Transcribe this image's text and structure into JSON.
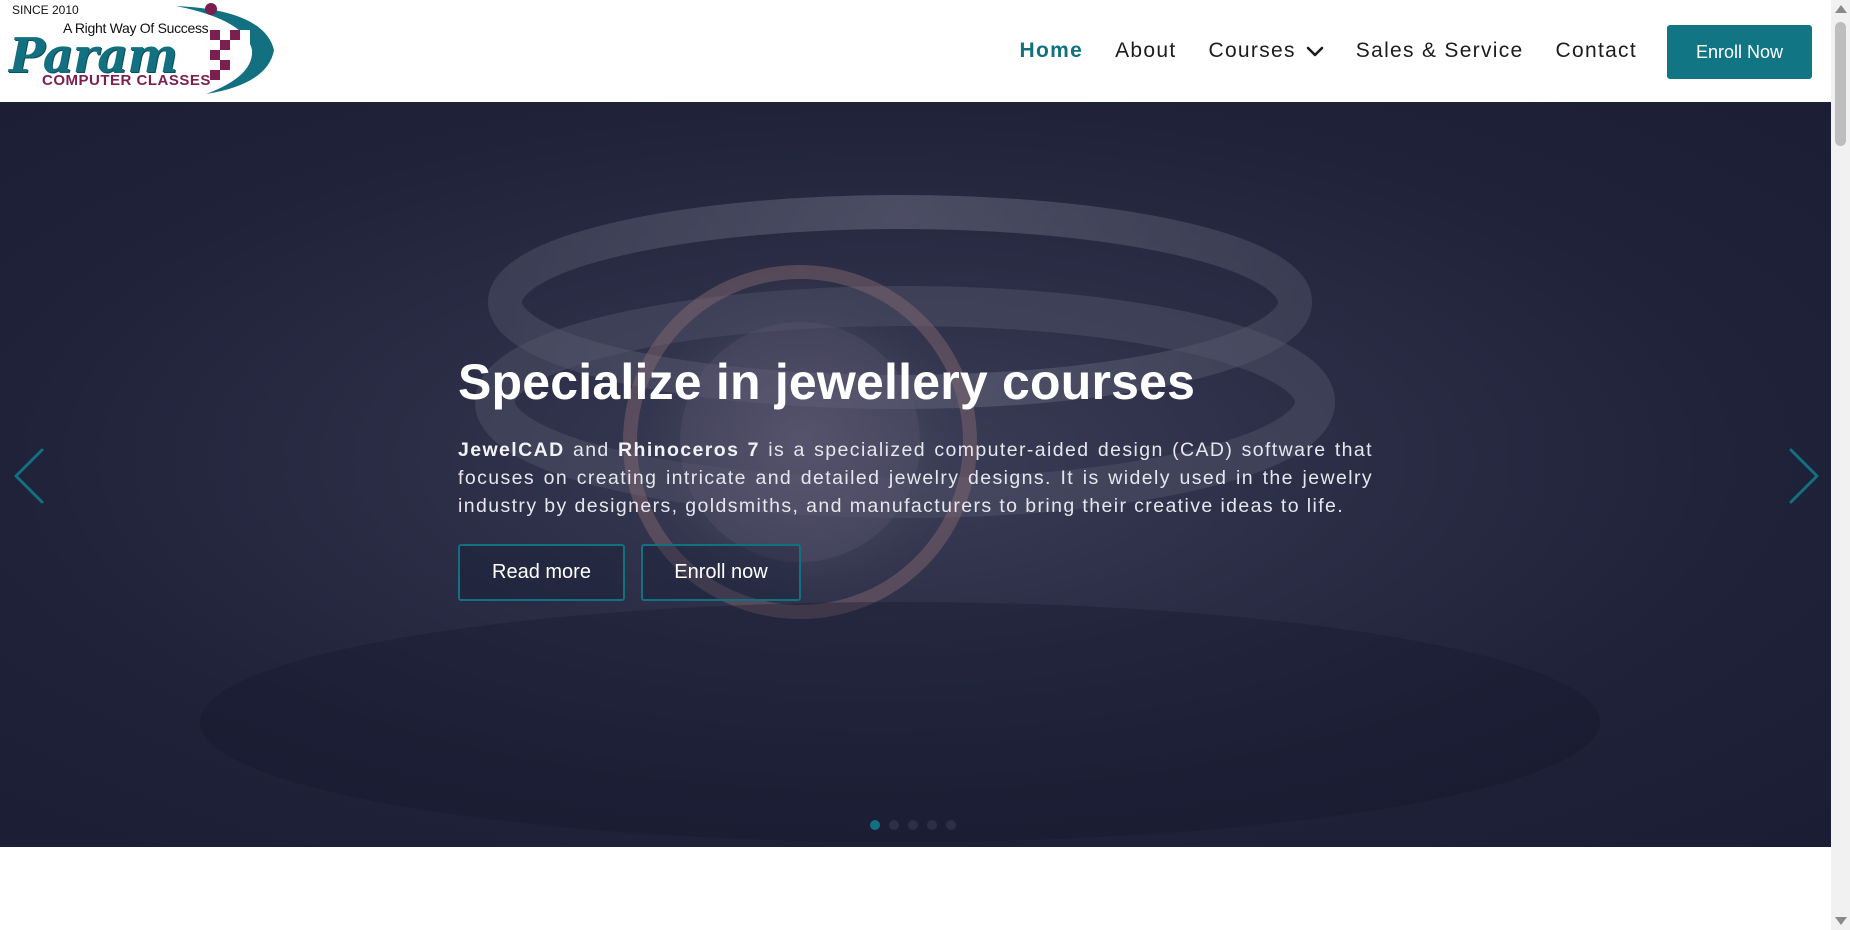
{
  "logo": {
    "since": "SINCE 2010",
    "tagline": "A Right Way Of Success",
    "brand": "Param",
    "sub": "COMPUTER CLASSES"
  },
  "nav": {
    "items": [
      {
        "label": "Home",
        "active": true
      },
      {
        "label": "About"
      },
      {
        "label": "Courses",
        "has_dropdown": true
      },
      {
        "label": "Sales & Service"
      },
      {
        "label": "Contact"
      }
    ],
    "enroll_label": "Enroll Now"
  },
  "hero": {
    "title": "Specialize in jewellery courses",
    "desc_bold_1": "JewelCAD",
    "desc_and": " and ",
    "desc_bold_2": "Rhinoceros 7",
    "desc_rest": " is a specialized computer-aided design (CAD) software that focuses on creating intricate and detailed jewelry designs. It is widely used in the jewelry industry by designers, goldsmiths, and manufacturers to bring their creative ideas to life.",
    "read_more": "Read more",
    "enroll_now": "Enroll now",
    "slide_count": 5,
    "active_slide": 1
  },
  "colors": {
    "accent": "#127080",
    "logo_maroon": "#7a1f4e",
    "hero_bg": "#23263d"
  },
  "icons": [
    "chevron-down-icon",
    "chevron-left-icon",
    "chevron-right-icon",
    "logo-mark-icon"
  ]
}
